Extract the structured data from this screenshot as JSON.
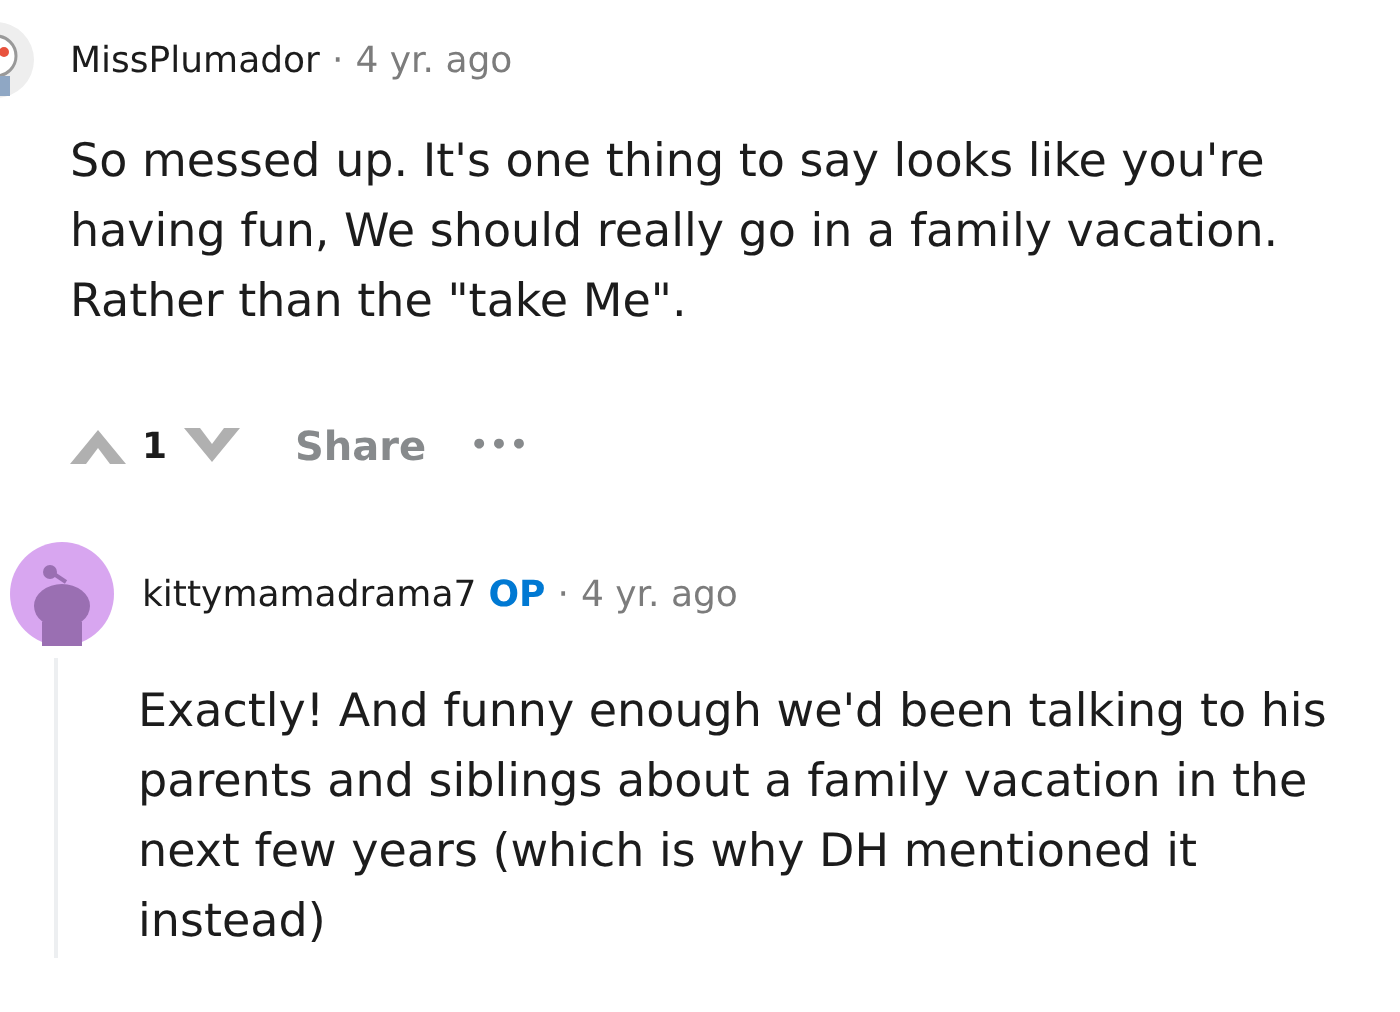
{
  "comments": [
    {
      "kind": "cropped",
      "author": "MissPlumador",
      "op": false,
      "separator": "·",
      "time": "4 yr. ago",
      "body": "So messed up. It's one thing to say looks like you're having fun, We should really go in a family vacation. Rather than the \"take Me\".",
      "votes": "1",
      "share": "Share",
      "more": "•••",
      "thread": false
    },
    {
      "kind": "full",
      "author": "kittymamadrama7",
      "op": true,
      "op_label": "OP",
      "separator": "·",
      "time": "4 yr. ago",
      "body": "Exactly! And funny enough we'd been talking to his parents and siblings about a family vacation in the next few years (which is why DH mentioned it instead)",
      "thread": true
    }
  ]
}
